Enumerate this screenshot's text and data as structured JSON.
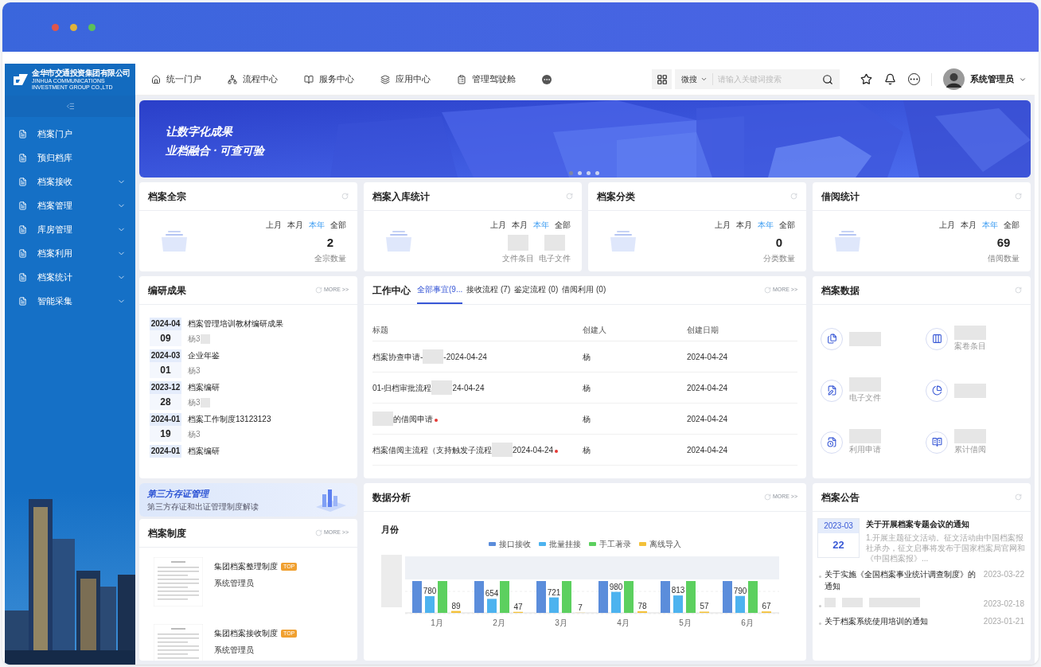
{
  "sidebar": {
    "logo": {
      "name": "金华市交通投资集团有限公司",
      "subtitle": "JINHUA COMMUNICATIONS INVESTMENT GROUP CO.,LTD"
    },
    "items": [
      {
        "label": "档案门户",
        "expandable": false
      },
      {
        "label": "预归档库",
        "expandable": false
      },
      {
        "label": "档案接收",
        "expandable": true
      },
      {
        "label": "档案管理",
        "expandable": true
      },
      {
        "label": "库房管理",
        "expandable": true
      },
      {
        "label": "档案利用",
        "expandable": true
      },
      {
        "label": "档案统计",
        "expandable": true
      },
      {
        "label": "智能采集",
        "expandable": true
      }
    ]
  },
  "top_nav": {
    "items": [
      {
        "kind": "home",
        "label": "统一门户"
      },
      {
        "kind": "sitemap",
        "label": "流程中心"
      },
      {
        "kind": "book",
        "label": "服务中心"
      },
      {
        "kind": "layers",
        "label": "应用中心"
      },
      {
        "kind": "badge",
        "label": "管理驾驶舱"
      },
      {
        "kind": "more"
      }
    ]
  },
  "search": {
    "scope": "微搜",
    "placeholder": "请输入关键词搜索"
  },
  "user": {
    "name": "系统管理员"
  },
  "banner": {
    "lines": [
      "让数字化成果",
      "业档融合 · 可查可验"
    ],
    "slides": [
      {
        "selected": true
      },
      {
        "selected": false
      },
      {
        "selected": false
      },
      {
        "selected": false
      }
    ]
  },
  "stat_cards": [
    {
      "title": "档案全宗",
      "periods": [
        {
          "label": "上月",
          "selected": false
        },
        {
          "label": "本月",
          "selected": false
        },
        {
          "label": "本年",
          "selected": true
        },
        {
          "label": "全部",
          "selected": false
        }
      ],
      "stats": [
        {
          "value": "2",
          "label": "全宗数量"
        }
      ]
    },
    {
      "title": "档案入库统计",
      "periods": [
        {
          "label": "上月",
          "selected": false
        },
        {
          "label": "本月",
          "selected": false
        },
        {
          "label": "本年",
          "selected": true
        },
        {
          "label": "全部",
          "selected": false
        }
      ],
      "stats": [
        {
          "label": "文件条目"
        },
        {
          "label": "电子文件"
        }
      ]
    },
    {
      "title": "档案分类",
      "periods": [
        {
          "label": "上月",
          "selected": false
        },
        {
          "label": "本月",
          "selected": false
        },
        {
          "label": "本年",
          "selected": true
        },
        {
          "label": "全部",
          "selected": false
        }
      ],
      "stats": [
        {
          "value": "0",
          "label": "分类数量"
        }
      ]
    },
    {
      "title": "借阅统计",
      "periods": [
        {
          "label": "上月",
          "selected": false
        },
        {
          "label": "本月",
          "selected": false
        },
        {
          "label": "本年",
          "selected": true
        },
        {
          "label": "全部",
          "selected": false
        }
      ],
      "stats": [
        {
          "value": "69",
          "label": "借阅数量"
        }
      ]
    }
  ],
  "research": {
    "title": "编研成果",
    "more": "MORE >>",
    "items": [
      {
        "month": "2024-04",
        "day": "09",
        "title": "档案管理培训教材编研成果",
        "author": "杨3",
        "redacted": true
      },
      {
        "month": "2024-03",
        "day": "01",
        "title": "企业年鉴",
        "author": "杨3",
        "redacted": false
      },
      {
        "month": "2023-12",
        "day": "28",
        "title": "档案编研",
        "author": "杨3",
        "redacted": true
      },
      {
        "month": "2024-01",
        "day": "19",
        "title": "档案工作制度13123123",
        "author": "杨3",
        "redacted": false
      },
      {
        "month": "2024-01",
        "title": "档案编研"
      }
    ]
  },
  "work_center": {
    "title": "工作中心",
    "more": "MORE >>",
    "tabs": [
      {
        "label": "全部事宜(9...",
        "selected": true
      },
      {
        "label": "接收流程 (7)",
        "selected": false
      },
      {
        "label": "鉴定流程 (0)",
        "selected": false
      },
      {
        "label": "借阅利用 (0)",
        "selected": false
      }
    ],
    "columns": [
      "标题",
      "创建人",
      "创建日期"
    ],
    "rows": [
      {
        "title": [
          {
            "kind": "text",
            "text": "档案协查申请-"
          },
          {
            "kind": "redacted"
          },
          {
            "kind": "text",
            "text": "-2024-04-24"
          }
        ],
        "creator": "杨",
        "date": "2024-04-24",
        "unread": false
      },
      {
        "title": [
          {
            "kind": "text",
            "text": "01-归档审批流程"
          },
          {
            "kind": "redacted"
          },
          {
            "kind": "text",
            "text": "24-04-24"
          }
        ],
        "creator": "杨",
        "date": "2024-04-24",
        "unread": false
      },
      {
        "title": [
          {
            "kind": "redacted"
          },
          {
            "kind": "text",
            "text": "的借阅申请"
          }
        ],
        "creator": "杨",
        "date": "2024-04-24",
        "unread": true
      },
      {
        "title": [
          {
            "kind": "text",
            "text": "档案借阅主流程（支持触发子流程"
          },
          {
            "kind": "redacted"
          },
          {
            "kind": "text",
            "text": "2024-04-24"
          }
        ],
        "creator": "杨",
        "date": "2024-04-24",
        "unread": true
      }
    ]
  },
  "archive_data": {
    "title": "档案数据",
    "items": [
      {
        "kind": "stack"
      },
      {
        "kind": "columns",
        "label": "案卷条目"
      },
      {
        "kind": "document",
        "label": "电子文件"
      },
      {
        "kind": "pie"
      },
      {
        "kind": "request",
        "label": "利用申请"
      },
      {
        "kind": "book",
        "label": "累计借阅"
      }
    ]
  },
  "promo": {
    "title": "第三方存证管理",
    "subtitle": "第三方存证和出证管理制度解读"
  },
  "regulations": {
    "title": "档案制度",
    "more": "MORE >>",
    "items": [
      {
        "title": "集团档案整理制度",
        "badge": "TOP",
        "author": "系统管理员"
      },
      {
        "title": "集团档案接收制度",
        "badge": "TOP",
        "author": "系统管理员"
      }
    ]
  },
  "analysis": {
    "title": "数据分析",
    "more": "MORE >>",
    "chart_data": {
      "type": "bar",
      "title": "月份",
      "categories": [
        "1月",
        "2月",
        "3月",
        "4月",
        "5月",
        "6月"
      ],
      "data_labels": true,
      "legend": "top",
      "series": [
        {
          "name": "接口接收",
          "color": "#5b8ddb",
          "values": [
            null,
            null,
            null,
            null,
            null,
            null
          ]
        },
        {
          "name": "批量挂接",
          "color": "#4db3ef",
          "values": [
            780,
            654,
            721,
            980,
            813,
            790
          ]
        },
        {
          "name": "手工著录",
          "color": "#5cd05f",
          "values": [
            null,
            null,
            null,
            null,
            null,
            null
          ]
        },
        {
          "name": "离线导入",
          "color": "#f3c13a",
          "values": [
            89,
            47,
            7,
            78,
            57,
            67
          ]
        }
      ]
    }
  },
  "notices": {
    "title": "档案公告",
    "featured": {
      "month": "2023-03",
      "day": "22",
      "title": "关于开展档案专题会议的通知",
      "body": "1.开展主题征文活动。征文活动由中国档案报社承办，征文启事将发布于国家档案局官网和《中国档案报》..."
    },
    "items": [
      {
        "kind": "text",
        "title": "关于实施《全国档案事业统计调查制度》的通知",
        "date": "2023-03-22"
      },
      {
        "kind": "redacted",
        "date": "2023-02-18"
      },
      {
        "kind": "text",
        "title": "关于档案系统使用培训的通知",
        "date": "2023-01-21"
      }
    ]
  }
}
